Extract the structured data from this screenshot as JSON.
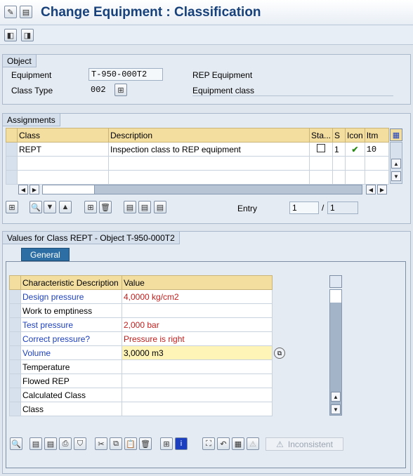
{
  "window": {
    "title": "Change Equipment : Classification"
  },
  "toolbar": {
    "back_icon": "back-icon",
    "forward_icon": "forward-icon"
  },
  "object": {
    "section_title": "Object",
    "equipment_label": "Equipment",
    "equipment_value": "T-950-000T2",
    "equipment_desc": "REP Equipment",
    "class_type_label": "Class Type",
    "class_type_value": "002",
    "class_type_desc": "Equipment class"
  },
  "assignments": {
    "section_title": "Assignments",
    "columns": [
      "Class",
      "Description",
      "Sta...",
      "S",
      "Icon",
      "Itm"
    ],
    "rows": [
      {
        "class": "REPT",
        "description": "Inspection class to REP equipment",
        "status_checked": false,
        "s": "1",
        "icon": "check-icon",
        "itm": "10"
      }
    ],
    "entry_label": "Entry",
    "entry_value": "1",
    "entry_sep": "/",
    "entry_total": "1"
  },
  "values": {
    "section_title": "Values for Class REPT - Object T-950-000T2",
    "tab_general": "General",
    "col_desc": "Characteristic Description",
    "col_value": "Value",
    "rows": [
      {
        "desc": "Design pressure",
        "value": "4,0000 kg/cm2",
        "desc_color": "blue",
        "value_color": "red"
      },
      {
        "desc": "Work to emptiness",
        "value": "",
        "desc_color": "black",
        "value_color": "black"
      },
      {
        "desc": "Test pressure",
        "value": "2,000 bar",
        "desc_color": "blue",
        "value_color": "red"
      },
      {
        "desc": "Correct pressure?",
        "value": "Pressure is right",
        "desc_color": "blue",
        "value_color": "red"
      },
      {
        "desc": "Volume",
        "value": "3,0000 m3",
        "desc_color": "blue",
        "value_color": "black"
      },
      {
        "desc": "Temperature",
        "value": "",
        "desc_color": "black",
        "value_color": "black"
      },
      {
        "desc": "Flowed REP",
        "value": "",
        "desc_color": "black",
        "value_color": "black"
      },
      {
        "desc": "Calculated Class",
        "value": "",
        "desc_color": "black",
        "value_color": "black"
      },
      {
        "desc": "Class",
        "value": "",
        "desc_color": "black",
        "value_color": "black"
      }
    ],
    "inconsistent_label": "Inconsistent"
  },
  "colors": {
    "header_bg": "#f3dea0",
    "title_color": "#17417a",
    "tab_active": "#2d6fa5",
    "highlight_row": "#fff4b8"
  }
}
